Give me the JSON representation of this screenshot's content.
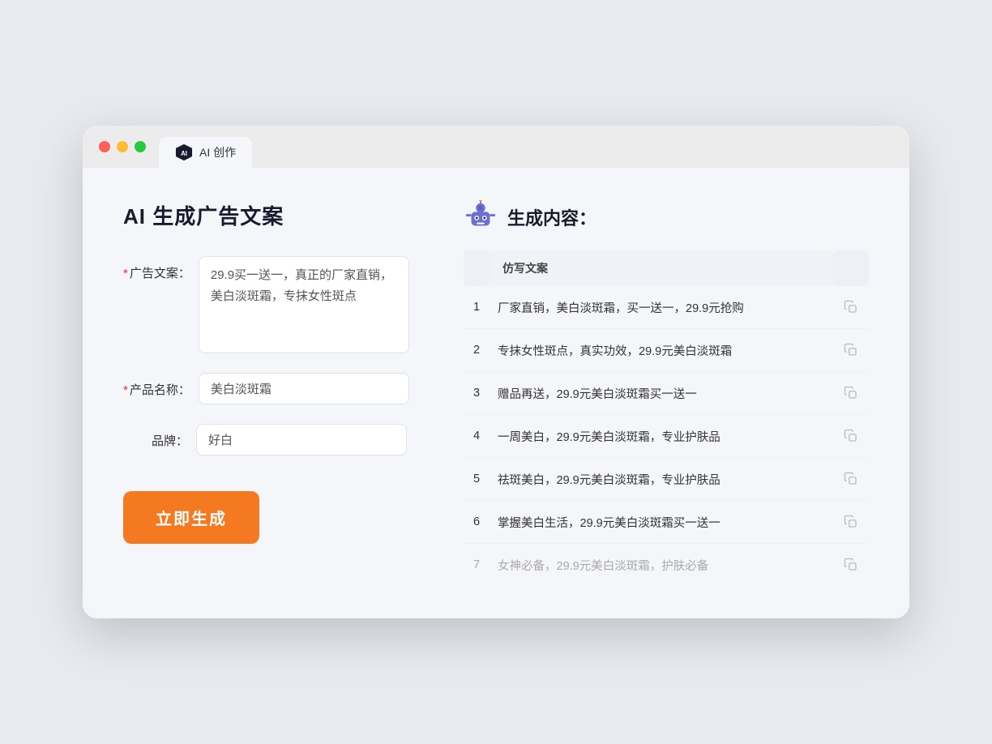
{
  "browser": {
    "tab_label": "AI 创作"
  },
  "page": {
    "title": "AI 生成广告文案",
    "result_section_title": "生成内容："
  },
  "form": {
    "ad_copy_label": "广告文案：",
    "ad_copy_required": "*",
    "ad_copy_value": "29.9买一送一，真正的厂家直销，美白淡斑霜，专抹女性斑点",
    "product_name_label": "产品名称：",
    "product_name_required": "*",
    "product_name_value": "美白淡斑霜",
    "brand_label": "品牌：",
    "brand_value": "好白",
    "generate_button": "立即生成"
  },
  "result": {
    "table_header": "仿写文案",
    "items": [
      {
        "id": 1,
        "text": "厂家直销，美白淡斑霜，买一送一，29.9元抢购",
        "faded": false
      },
      {
        "id": 2,
        "text": "专抹女性斑点，真实功效，29.9元美白淡斑霜",
        "faded": false
      },
      {
        "id": 3,
        "text": "赠品再送，29.9元美白淡斑霜买一送一",
        "faded": false
      },
      {
        "id": 4,
        "text": "一周美白，29.9元美白淡斑霜，专业护肤品",
        "faded": false
      },
      {
        "id": 5,
        "text": "祛斑美白，29.9元美白淡斑霜，专业护肤品",
        "faded": false
      },
      {
        "id": 6,
        "text": "掌握美白生活，29.9元美白淡斑霜买一送一",
        "faded": false
      },
      {
        "id": 7,
        "text": "女神必备，29.9元美白淡斑霜，护肤必备",
        "faded": true
      }
    ]
  }
}
